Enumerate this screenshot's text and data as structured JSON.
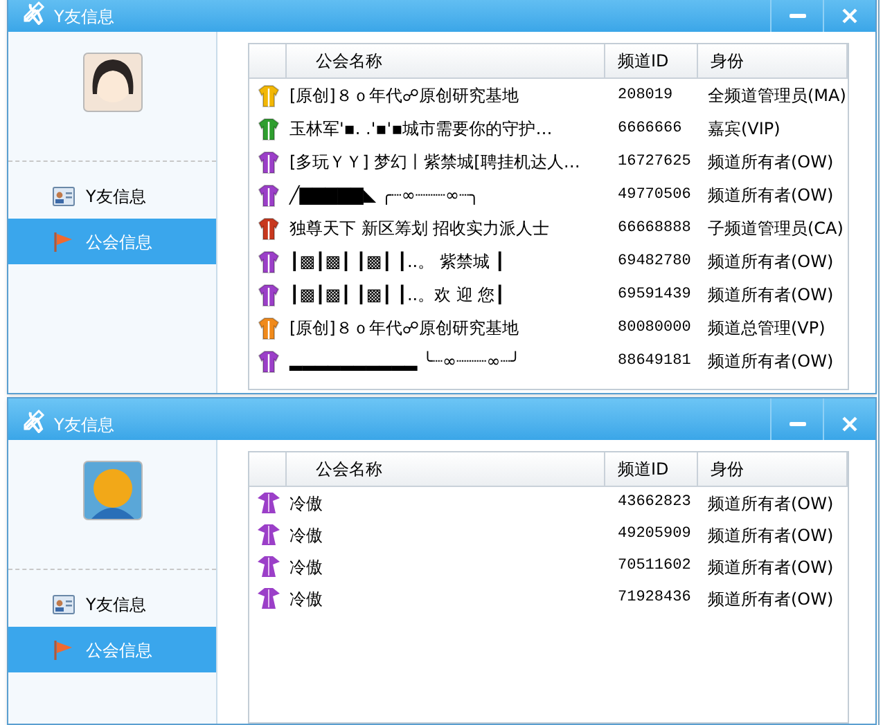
{
  "windows": [
    {
      "title": "Y友信息",
      "nav": [
        {
          "label": "Y友信息",
          "selected": false
        },
        {
          "label": "公会信息",
          "selected": true
        }
      ],
      "table": {
        "columns": [
          "公会名称",
          "频道ID",
          "身份"
        ],
        "rows": [
          {
            "kind": "shirt",
            "color": "#f2b705",
            "name": "[原创]８ｏ年代☍原创研究基地",
            "id": "208019",
            "role": "全频道管理员(MA)"
          },
          {
            "kind": "shirt",
            "color": "#2f9e2f",
            "name": "玉林军'▪.  .'▪'▪城市需要你的守护…",
            "id": "6666666",
            "role": "嘉宾(VIP)"
          },
          {
            "kind": "shirt",
            "color": "#9b3fc8",
            "name": "[多玩ＹＹ]  梦幻丨紫禁城[聘挂机达人…",
            "id": "16727625",
            "role": "频道所有者(OW)"
          },
          {
            "kind": "shirt",
            "color": "#9b3fc8",
            "name": "╱▇▇▇▇▇◣  ╭┈∞┈┈┈∞┈╮",
            "id": "49770506",
            "role": "频道所有者(OW)"
          },
          {
            "kind": "shirt",
            "color": "#c8381e",
            "name": "独尊天下  新区筹划 招收实力派人士",
            "id": "66668888",
            "role": "子频道管理员(CA)"
          },
          {
            "kind": "shirt",
            "color": "#9b3fc8",
            "name": "┃▩┃▩┃ ┃▩┃ ┃..。 紫禁城 ┃",
            "id": "69482780",
            "role": "频道所有者(OW)"
          },
          {
            "kind": "shirt",
            "color": "#9b3fc8",
            "name": "┃▩┃▩┃ ┃▩┃ ┃..。欢 迎 您┃",
            "id": "69591439",
            "role": "频道所有者(OW)"
          },
          {
            "kind": "shirt",
            "color": "#f08a1c",
            "name": "[原创]８ｏ年代☍原创研究基地",
            "id": "80080000",
            "role": "频道总管理(VP)"
          },
          {
            "kind": "shirt",
            "color": "#9b3fc8",
            "name": "▂▂▂▂▂▂▂▂▂▂ ╰┈∞┈┈┈∞┈╯",
            "id": "88649181",
            "role": "频道所有者(OW)"
          }
        ]
      }
    },
    {
      "title": "Y友信息",
      "nav": [
        {
          "label": "Y友信息",
          "selected": false
        },
        {
          "label": "公会信息",
          "selected": true
        }
      ],
      "table": {
        "columns": [
          "公会名称",
          "频道ID",
          "身份"
        ],
        "rows": [
          {
            "kind": "robe",
            "color": "#9b3fc8",
            "name": "冷傲",
            "id": "43662823",
            "role": "频道所有者(OW)"
          },
          {
            "kind": "robe",
            "color": "#9b3fc8",
            "name": "冷傲",
            "id": "49205909",
            "role": "频道所有者(OW)"
          },
          {
            "kind": "robe",
            "color": "#9b3fc8",
            "name": "冷傲",
            "id": "70511602",
            "role": "频道所有者(OW)"
          },
          {
            "kind": "robe",
            "color": "#9b3fc8",
            "name": "冷傲",
            "id": "71928436",
            "role": "频道所有者(OW)"
          }
        ]
      }
    }
  ]
}
